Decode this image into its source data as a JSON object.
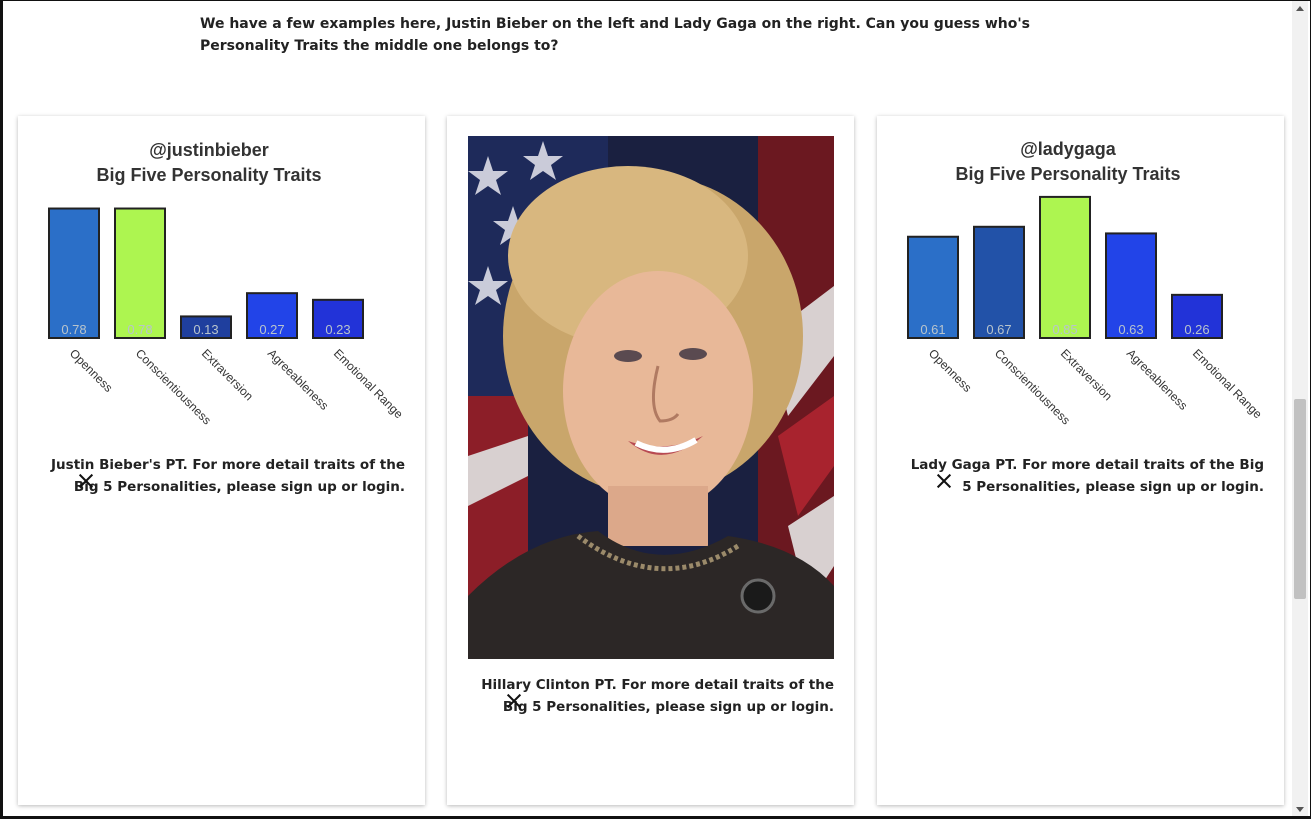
{
  "intro": {
    "text": "We have a few examples here, Justin Bieber on the left and Lady Gaga on the right. Can you guess who's Personality Traits the middle one belongs to?"
  },
  "cards": [
    {
      "caption": "Justin Bieber's PT. For more detail traits of the Big 5 Personalities, please sign up or login."
    },
    {
      "caption": "Hillary Clinton PT. For more detail traits of the Big 5 Personalities, please sign up or login."
    },
    {
      "caption": "Lady Gaga PT. For more detail traits of the Big 5 Personalities, please sign up or login."
    }
  ],
  "chart_data": [
    {
      "type": "bar",
      "title": "@justinbieber",
      "subtitle": "Big Five Personality Traits",
      "categories": [
        "Openness",
        "Conscientiousness",
        "Extraversion",
        "Agreeableness",
        "Emotional Range"
      ],
      "values": [
        0.78,
        0.78,
        0.13,
        0.27,
        0.23
      ],
      "value_labels": [
        "0.78",
        "0.78",
        "0.13",
        "0.27",
        "0.23"
      ],
      "colors": [
        "#2b6fc8",
        "#adf550",
        "#1f3f9e",
        "#2244e8",
        "#2233d8"
      ],
      "ylim": [
        0,
        1
      ],
      "grid": false
    },
    {
      "type": "bar",
      "title": "@ladygaga",
      "subtitle": "Big Five Personality Traits",
      "categories": [
        "Openness",
        "Conscientiousness",
        "Extraversion",
        "Agreeableness",
        "Emotional Range"
      ],
      "values": [
        0.61,
        0.67,
        0.85,
        0.63,
        0.26
      ],
      "value_labels": [
        "0.61",
        "0.67",
        "0.85",
        "0.63",
        "0.26"
      ],
      "colors": [
        "#2b6fc8",
        "#2252a8",
        "#adf550",
        "#2244e8",
        "#2233d8"
      ],
      "ylim": [
        0,
        1
      ],
      "grid": false
    }
  ]
}
